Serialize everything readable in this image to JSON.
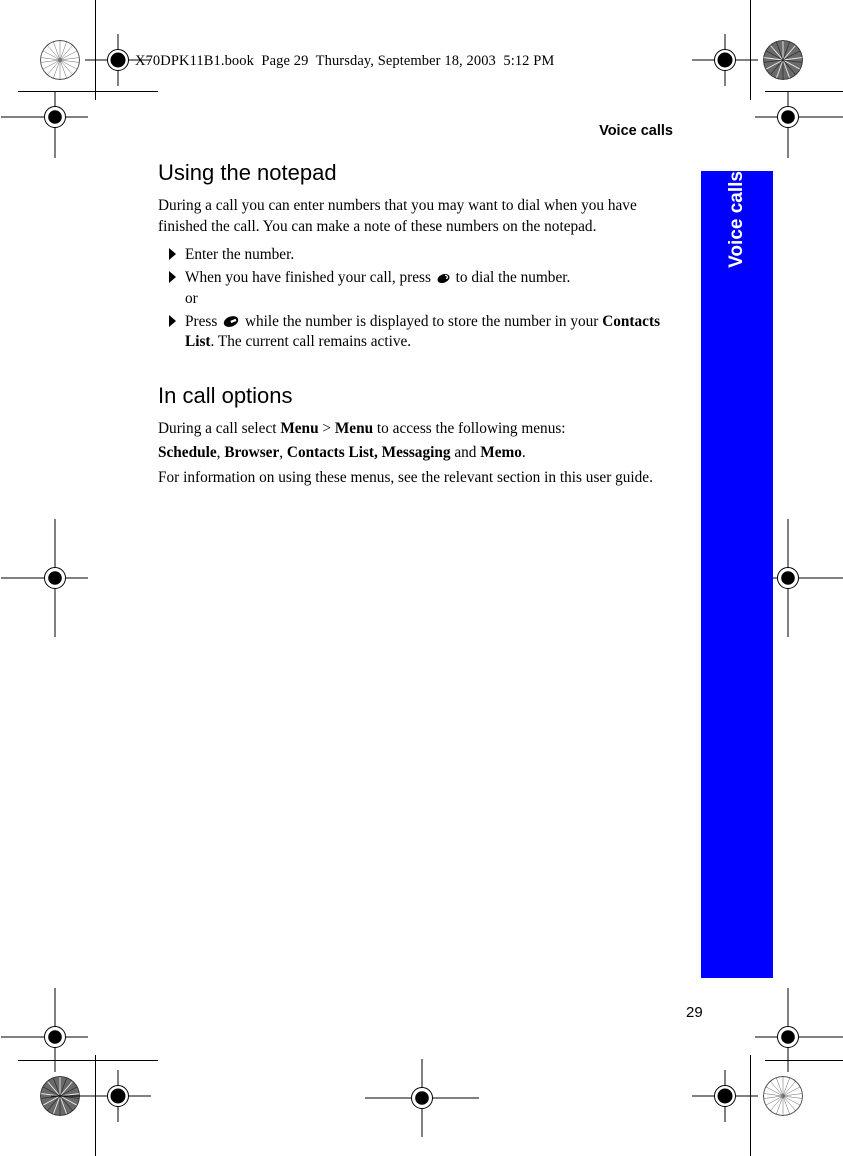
{
  "file_header": "X70DPK11B1.book  Page 29  Thursday, September 18, 2003  5:12 PM",
  "running_header": "Voice calls",
  "thumb_tab": {
    "label": "Voice calls",
    "color": "#0000ff",
    "text_color": "#ffffff"
  },
  "page_number": "29",
  "sections": [
    {
      "heading": "Using the notepad",
      "intro": "During a call you can enter numbers that you may want to dial when you have finished the call. You can make a note of these numbers on the notepad.",
      "steps": [
        {
          "bullet_icon": "triangle-right-icon",
          "parts": [
            {
              "type": "text",
              "value": "Enter the number."
            }
          ]
        },
        {
          "bullet_icon": "triangle-right-icon",
          "parts": [
            {
              "type": "text",
              "value": "When you have finished your call, press "
            },
            {
              "type": "icon",
              "value": "send-key-icon"
            },
            {
              "type": "text",
              "value": " to dial the number."
            }
          ],
          "sub_line": "or"
        },
        {
          "bullet_icon": "triangle-right-icon",
          "parts": [
            {
              "type": "text",
              "value": "Press "
            },
            {
              "type": "icon",
              "value": "store-key-icon"
            },
            {
              "type": "text",
              "value": "  while the number is displayed to store the number in your "
            },
            {
              "type": "bold",
              "value": "Contacts List"
            },
            {
              "type": "text",
              "value": ". The current call remains active."
            }
          ]
        }
      ]
    },
    {
      "heading": "In call options",
      "paragraph_1": {
        "lead": "During a call select ",
        "menu_1": "Menu",
        "separator": " > ",
        "menu_2": "Menu",
        "tail": " to access the following menus:"
      },
      "menu_list": {
        "item_1": "Schedule",
        "sep_1": ", ",
        "item_2": "Browser",
        "sep_2": ", ",
        "item_3": "Contacts List, Messaging",
        "sep_3": " and ",
        "item_4": "Memo",
        "sep_4": "."
      },
      "paragraph_2": "For information on using these menus, see the relevant section in this user guide."
    }
  ],
  "printer_marks": {
    "registration_icon": "registration-target-icon",
    "starburst_icon": "starburst-mark-icon",
    "trim_line_icon": "trim-line"
  }
}
